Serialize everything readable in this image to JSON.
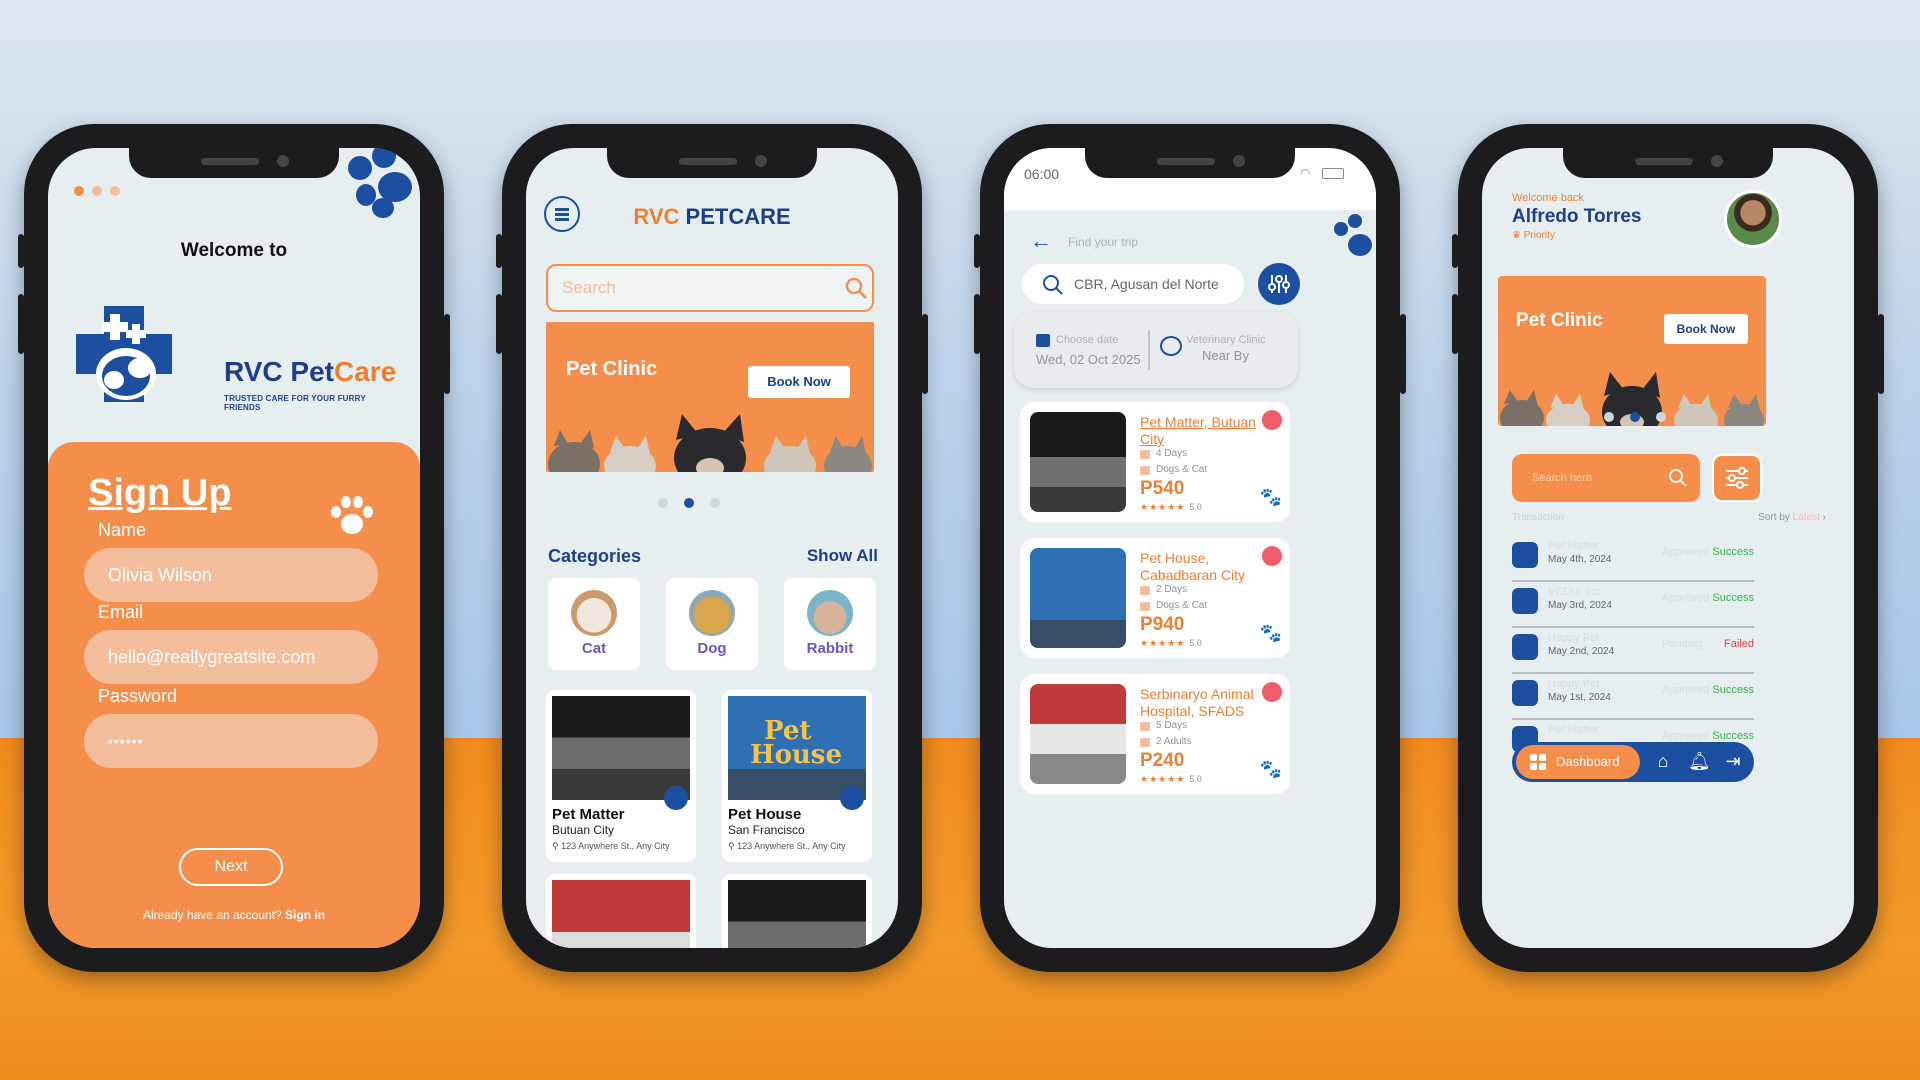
{
  "colors": {
    "orange": "#f58d4b",
    "navy": "#1d3f8a",
    "blue": "#1d4fa1",
    "success": "#35b44a",
    "failed": "#e0404a"
  },
  "phone1": {
    "welcome": "Welcome to",
    "brand_rvc": "RVC Pet",
    "brand_care": "Care",
    "tagline": "TRUSTED CARE FOR YOUR FURRY FRIENDS",
    "signup_title": "Sign Up",
    "name_label": "Name",
    "name_value": "Olivia Wilson",
    "email_label": "Email",
    "email_value": "hello@reallygreatsite.com",
    "password_label": "Password",
    "password_value": "••••••",
    "next_button": "Next",
    "have_account": "Already have an account?",
    "signin_link": "Sign in"
  },
  "phone2": {
    "title_rvc": "RVC",
    "title_petcare": "PETCARE",
    "search_placeholder": "Search",
    "banner_title": "Pet Clinic",
    "book_now": "Book Now",
    "categories_label": "Categories",
    "show_all": "Show All",
    "categories": [
      {
        "name": "Cat"
      },
      {
        "name": "Dog"
      },
      {
        "name": "Rabbit"
      }
    ],
    "clinics": [
      {
        "name": "Pet Matter",
        "city": "Butuan City",
        "address": "123 Anywhere St., Any City"
      },
      {
        "name": "Pet House",
        "city": "San Francisco",
        "address": "123 Anywhere St., Any City"
      }
    ]
  },
  "phone3": {
    "time": "06:00",
    "find_trip": "Find your trip",
    "search_value": "CBR, Agusan del Norte",
    "choose_date_label": "Choose date",
    "date_value": "Wed, 02 Oct 2025",
    "clinic_label": "Veterinary Clinic",
    "clinic_value": "Near By",
    "results": [
      {
        "name": "Pet Matter, Butuan City",
        "days": "4 Days",
        "type": "Dogs & Cat",
        "price": "P540",
        "rating": "5.0"
      },
      {
        "name": "Pet House, Cabadbaran City",
        "days": "2 Days",
        "type": "Dogs & Cat",
        "price": "P940",
        "rating": "5.0"
      },
      {
        "name": "Serbinaryo Animal Hospital, SFADS",
        "days": "5 Days",
        "type": "2 Adults",
        "price": "P240",
        "rating": "5.0"
      }
    ]
  },
  "phone4": {
    "welcome_back": "Welcome back",
    "user_name": "Alfredo Torres",
    "priority": "Priority",
    "banner_title": "Pet Clinic",
    "book_now": "Book Now",
    "search_placeholder": "Search here",
    "transaction_label": "Transaction",
    "sort_by": "Sort by",
    "sort_value": "Latest",
    "transactions": [
      {
        "name": "Pet Matter",
        "date": "May 4th, 2024",
        "status": "Approved",
        "result": "Success"
      },
      {
        "name": "VCDU, Inc.",
        "date": "May 3rd, 2024",
        "status": "Approved",
        "result": "Success"
      },
      {
        "name": "Happy Pet",
        "date": "May 2nd, 2024",
        "status": "Pending",
        "result": "Failed"
      },
      {
        "name": "Happy Pet",
        "date": "May 1st, 2024",
        "status": "Approved",
        "result": "Success"
      },
      {
        "name": "Pet Matter",
        "date": "",
        "status": "Approved",
        "result": "Success"
      }
    ],
    "nav_dashboard": "Dashboard"
  }
}
